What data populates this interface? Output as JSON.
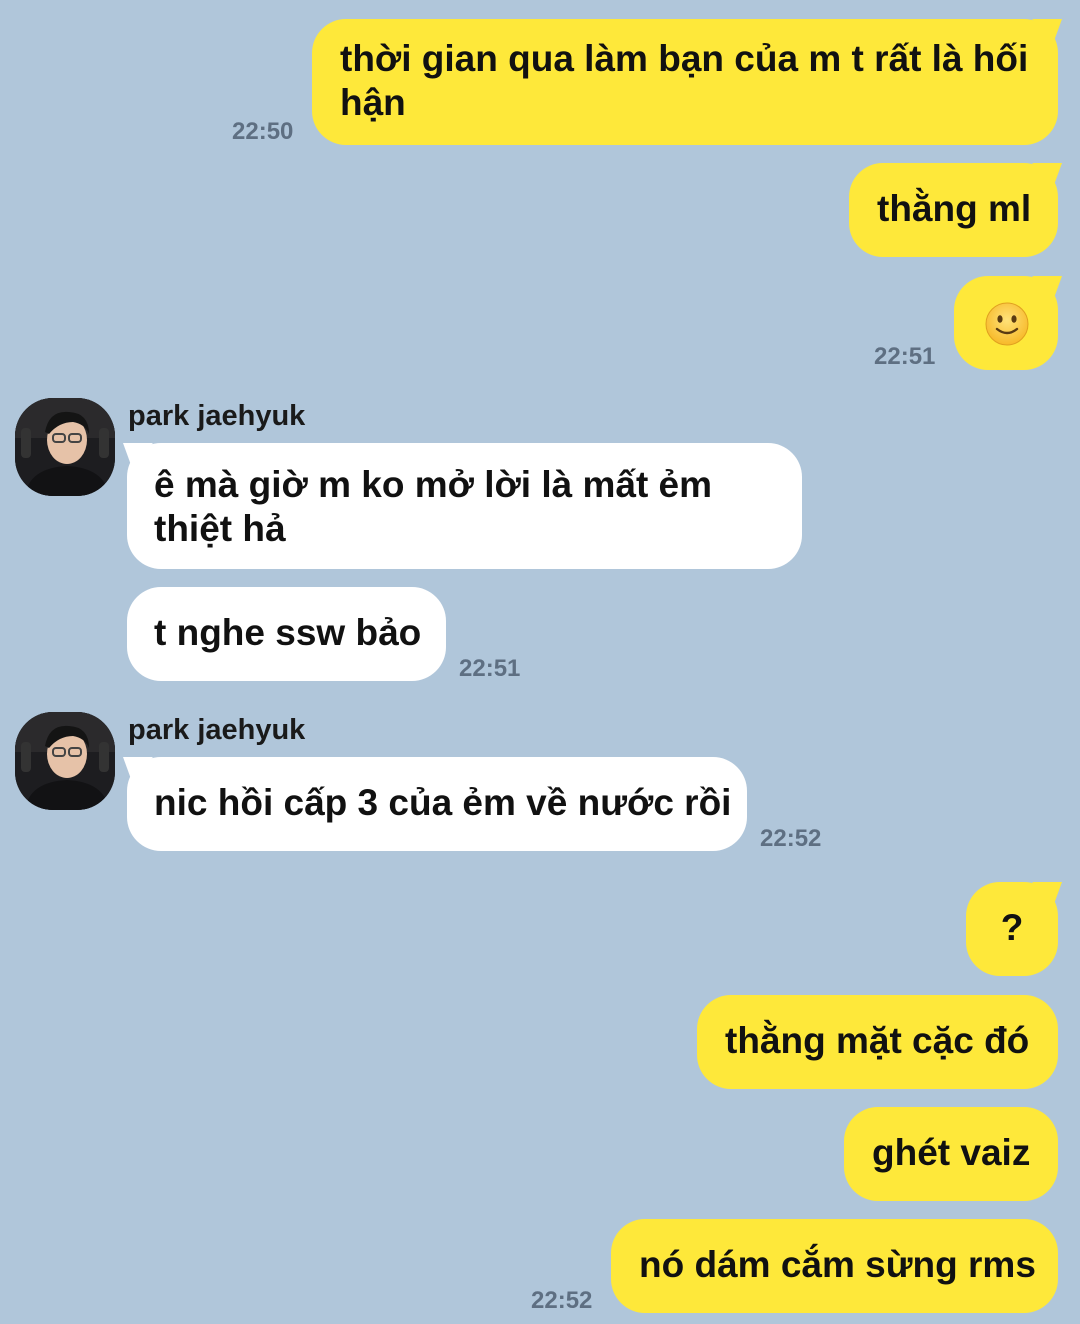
{
  "messages": {
    "m1": {
      "text": "thời gian qua làm bạn của m t rất là hối hận",
      "line1": "thời gian qua làm bạn của m t rất là hối",
      "line2": "hận",
      "time": "22:50"
    },
    "m2": {
      "text": "thằng ml"
    },
    "m3": {
      "emoji": "slightly-smiling-face-icon",
      "time": "22:51"
    },
    "g1": {
      "sender": "park jaehyuk",
      "b1_line1": "ê mà giờ m ko mở lời là mất ẻm",
      "b1_line2": "thiệt hả",
      "b2": "t nghe ssw bảo",
      "time": "22:51"
    },
    "g2": {
      "sender": "park jaehyuk",
      "b1": "nic hồi cấp 3 của ẻm về nước rồi",
      "time": "22:52"
    },
    "m4": {
      "text": "?"
    },
    "m5": {
      "text": "thằng mặt cặc đó"
    },
    "m6": {
      "text": "ghét vaiz"
    },
    "m7": {
      "text": "nó dám cắm sừng rms",
      "time": "22:52"
    }
  },
  "colors": {
    "background": "#b0c6da",
    "my_bubble": "#fee83a",
    "their_bubble": "#ffffff",
    "timestamp": "#5e6f82"
  }
}
